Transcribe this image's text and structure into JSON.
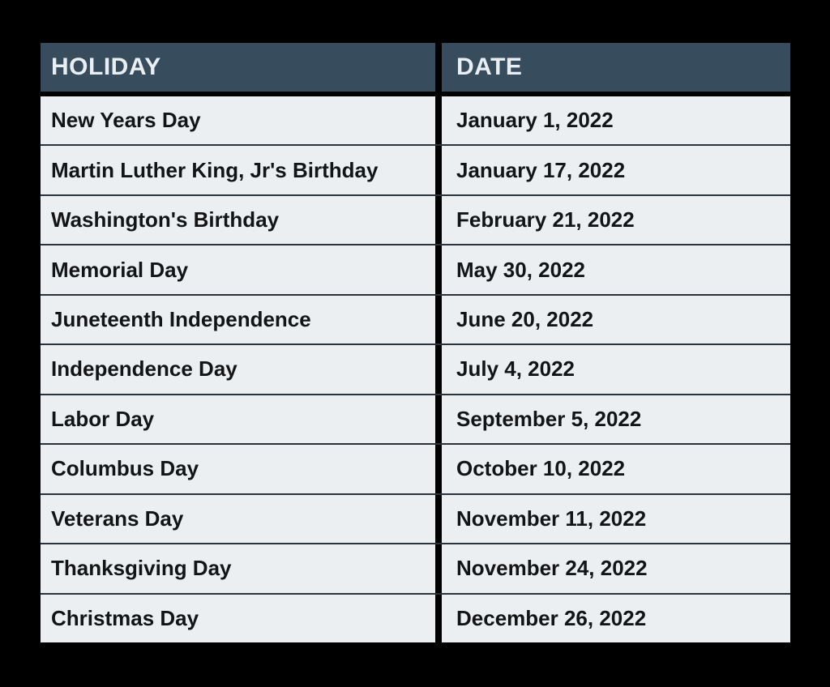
{
  "table": {
    "columns": [
      {
        "key": "holiday",
        "label": "HOLIDAY"
      },
      {
        "key": "date",
        "label": "DATE"
      }
    ],
    "rows": [
      {
        "holiday": "New Years Day",
        "date": "January 1, 2022"
      },
      {
        "holiday": "Martin Luther King, Jr's Birthday",
        "date": "January 17, 2022"
      },
      {
        "holiday": "Washington's Birthday",
        "date": "February 21, 2022"
      },
      {
        "holiday": "Memorial Day",
        "date": "May 30, 2022"
      },
      {
        "holiday": "Juneteenth Independence",
        "date": "June 20, 2022"
      },
      {
        "holiday": "Independence Day",
        "date": "July 4, 2022"
      },
      {
        "holiday": "Labor Day",
        "date": "September 5, 2022"
      },
      {
        "holiday": "Columbus Day",
        "date": "October 10, 2022"
      },
      {
        "holiday": "Veterans Day",
        "date": "November 11, 2022"
      },
      {
        "holiday": "Thanksgiving Day",
        "date": "November 24, 2022"
      },
      {
        "holiday": "Christmas Day",
        "date": "December 26, 2022"
      }
    ]
  },
  "colors": {
    "page_background": "#000000",
    "header_background": "#374d5e",
    "header_text": "#e9eef2",
    "cell_background": "#eceff1",
    "cell_text": "#131416",
    "row_divider": "#2b3238"
  }
}
